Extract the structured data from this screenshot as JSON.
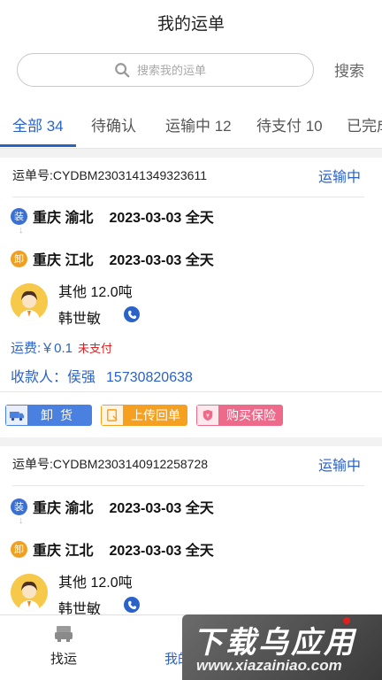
{
  "header": {
    "title": "我的运单"
  },
  "search": {
    "placeholder": "搜索我的运单",
    "button_label": "搜索"
  },
  "tabs": [
    {
      "label": "全部 34",
      "active": true
    },
    {
      "label": "待确认",
      "active": false
    },
    {
      "label": "运输中 12",
      "active": false
    },
    {
      "label": "待支付 10",
      "active": false
    },
    {
      "label": "已完成",
      "active": false
    }
  ],
  "orders": [
    {
      "waybill": "运单号:CYDBM2303141349323611",
      "status": "运输中",
      "load_badge": "装",
      "load_city": "重庆 渝北",
      "load_date": "2023-03-03 全天",
      "unload_badge": "卸",
      "unload_city": "重庆 江北",
      "unload_date": "2023-03-03 全天",
      "cargo": "其他   12.0吨",
      "driver": "韩世敏",
      "fee_label": "运费:￥0.1",
      "fee_status": "未支付",
      "payee_label": "收款人：侯强",
      "payee_phone": "15730820638",
      "actions": {
        "unload": "卸货",
        "upload_receipt": "上传回单",
        "buy_insurance": "购买保险"
      }
    },
    {
      "waybill": "运单号:CYDBM2303140912258728",
      "status": "运输中",
      "load_badge": "装",
      "load_city": "重庆 渝北",
      "load_date": "2023-03-03 全天",
      "unload_badge": "卸",
      "unload_city": "重庆 江北",
      "unload_date": "2023-03-03 全天",
      "cargo": "其他   12.0吨",
      "driver": "韩世敏"
    }
  ],
  "bottom_nav": [
    {
      "label": "找运",
      "icon": "truck-icon",
      "active": false
    },
    {
      "label": "我的运单",
      "icon": "waybill-icon",
      "active": true
    }
  ],
  "watermark": {
    "main": "下载乌应用",
    "sub": "www.xiazainiao.com"
  },
  "colors": {
    "accent": "#2a62c8",
    "unpaid": "#e02020",
    "load_badge": "#3a6fd4",
    "unload_badge": "#f0a020"
  }
}
